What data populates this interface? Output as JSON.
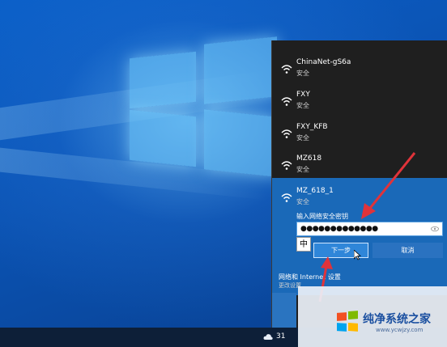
{
  "networks": [
    {
      "name": "ChinaNet-gS6a",
      "security": "安全"
    },
    {
      "name": "FXY",
      "security": "安全"
    },
    {
      "name": "FXY_KFB",
      "security": "安全"
    },
    {
      "name": "MZ618",
      "security": "安全"
    },
    {
      "name": "MZ_618_1",
      "security": "安全"
    }
  ],
  "password": {
    "label": "输入网络安全密钥",
    "value": "●●●●●●●●●●●●●"
  },
  "buttons": {
    "next": "下一步",
    "cancel": "取消"
  },
  "ime": "中",
  "settings": {
    "title": "网络和 Internet 设置",
    "subtitle": "更改设置"
  },
  "taskbar": {
    "temperature": "31"
  },
  "watermark": {
    "title": "纯净系统之家",
    "url": "www.ycwjzy.com"
  },
  "colors": {
    "accent": "#1a69b8",
    "arrow": "#e0333a"
  }
}
